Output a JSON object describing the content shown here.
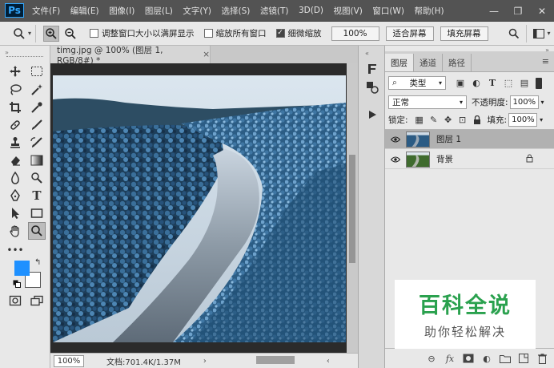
{
  "app": {
    "logo": "Ps"
  },
  "menu": [
    "文件(F)",
    "编辑(E)",
    "图像(I)",
    "图层(L)",
    "文字(Y)",
    "选择(S)",
    "滤镜(T)",
    "3D(D)",
    "视图(V)",
    "窗口(W)",
    "帮助(H)"
  ],
  "window_controls": {
    "minimize": "—",
    "restore": "❐",
    "close": "✕"
  },
  "options": {
    "resize_windows_label": "调整窗口大小以满屏显示",
    "resize_windows_checked": false,
    "zoom_all_label": "缩放所有窗口",
    "zoom_all_checked": false,
    "scrubby_zoom_label": "细微缩放",
    "scrubby_zoom_checked": true,
    "percent_button": "100%",
    "fit_screen_button": "适合屏幕",
    "fill_screen_button": "填充屏幕"
  },
  "document": {
    "tab_title": "timg.jpg @ 100% (图层 1, RGB/8#) *",
    "tab_close": "×",
    "zoom": "100%",
    "doc_info": "文档:701.4K/1.37M"
  },
  "colors": {
    "foreground": "#1e90ff",
    "background": "#ffffff",
    "accent": "#31a8ff"
  },
  "layers_panel": {
    "tabs": [
      "图层",
      "通道",
      "路径"
    ],
    "active_tab": "图层",
    "filter_kind": "类型",
    "blend_mode": "正常",
    "opacity_label": "不透明度:",
    "opacity": "100%",
    "lock_label": "锁定:",
    "fill_label": "填充:",
    "fill": "100%",
    "layers": [
      {
        "name": "图层 1",
        "selected": true,
        "locked": false
      },
      {
        "name": "背景",
        "selected": false,
        "locked": true
      }
    ]
  },
  "watermark": {
    "title": "百科全说",
    "subtitle": "助你轻松解决"
  }
}
